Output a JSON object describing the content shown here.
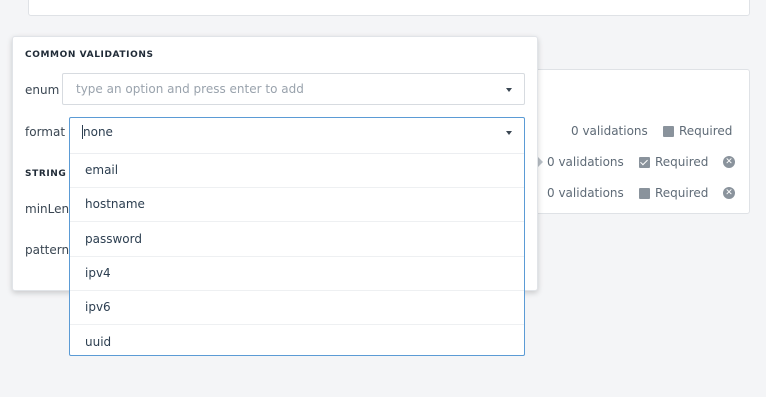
{
  "background": {
    "rows": [
      {
        "validations": "0 validations",
        "required_label": "Required",
        "required_checked": false,
        "removable": false,
        "caret": false
      },
      {
        "validations": "0 validations",
        "required_label": "Required",
        "required_checked": true,
        "removable": true,
        "caret": true
      },
      {
        "validations": "0 validations",
        "required_label": "Required",
        "required_checked": false,
        "removable": true,
        "caret": false
      }
    ],
    "remove_glyph": "✕"
  },
  "panel": {
    "common_title": "COMMON VALIDATIONS",
    "string_title": "STRING V",
    "enum_label": "enum",
    "enum_placeholder": "type an option and press enter to add",
    "format_label": "format",
    "minlength_label": "minLeng",
    "pattern_label": "pattern"
  },
  "format_dropdown": {
    "selected": "none",
    "options": [
      "email",
      "hostname",
      "password",
      "ipv4",
      "ipv6",
      "uuid"
    ]
  },
  "colors": {
    "focus_border": "#5b9bd5",
    "muted_text": "#5f6b77"
  }
}
